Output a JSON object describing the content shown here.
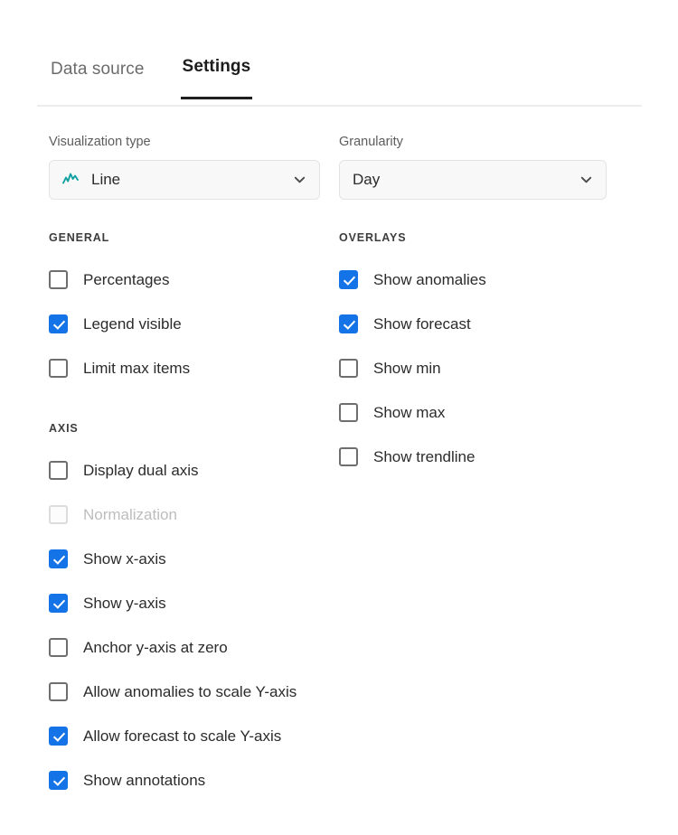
{
  "tabs": [
    {
      "label": "Data source",
      "active": false
    },
    {
      "label": "Settings",
      "active": true
    }
  ],
  "fields": {
    "visualization": {
      "label": "Visualization type",
      "value": "Line",
      "icon": "line-chart-icon",
      "icon_color": "#11a0a0",
      "chevron": "chevron-down-icon"
    },
    "granularity": {
      "label": "Granularity",
      "value": "Day",
      "chevron": "chevron-down-icon"
    }
  },
  "sections": {
    "general": {
      "title": "GENERAL",
      "items": [
        {
          "label": "Percentages",
          "checked": false,
          "disabled": false
        },
        {
          "label": "Legend visible",
          "checked": true,
          "disabled": false
        },
        {
          "label": "Limit max items",
          "checked": false,
          "disabled": false
        }
      ]
    },
    "axis": {
      "title": "AXIS",
      "items": [
        {
          "label": "Display dual axis",
          "checked": false,
          "disabled": false
        },
        {
          "label": "Normalization",
          "checked": false,
          "disabled": true
        },
        {
          "label": "Show x-axis",
          "checked": true,
          "disabled": false
        },
        {
          "label": "Show y-axis",
          "checked": true,
          "disabled": false
        },
        {
          "label": "Anchor y-axis at zero",
          "checked": false,
          "disabled": false
        },
        {
          "label": "Allow anomalies to scale Y-axis",
          "checked": false,
          "disabled": false
        },
        {
          "label": "Allow forecast to scale Y-axis",
          "checked": true,
          "disabled": false
        },
        {
          "label": "Show annotations",
          "checked": true,
          "disabled": false
        }
      ]
    },
    "overlays": {
      "title": "OVERLAYS",
      "items": [
        {
          "label": "Show anomalies",
          "checked": true,
          "disabled": false
        },
        {
          "label": "Show forecast",
          "checked": true,
          "disabled": false
        },
        {
          "label": "Show min",
          "checked": false,
          "disabled": false
        },
        {
          "label": "Show max",
          "checked": false,
          "disabled": false
        },
        {
          "label": "Show trendline",
          "checked": false,
          "disabled": false
        }
      ]
    }
  },
  "colors": {
    "accent_checked": "#1473e6",
    "viz_icon": "#11a0a0",
    "active_tab_underline": "#1f1f1f",
    "divider": "#ececec"
  }
}
